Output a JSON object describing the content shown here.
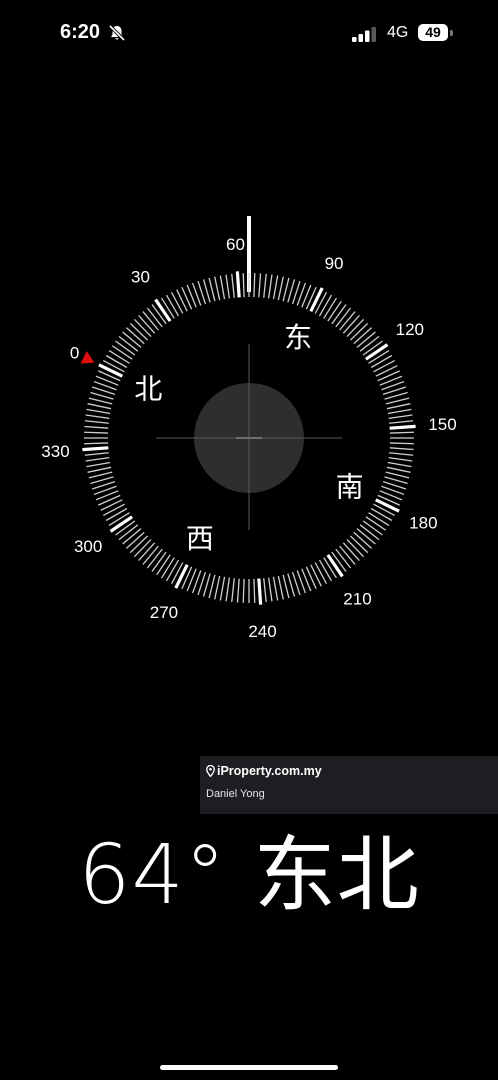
{
  "status_bar": {
    "time": "6:20",
    "mute_icon": "bell-slash-icon",
    "signal_icon": "cellular-signal-icon",
    "network": "4G",
    "battery": "49"
  },
  "compass": {
    "heading_degrees": 64,
    "degree_labels": [
      "0",
      "30",
      "60",
      "90",
      "120",
      "150",
      "180",
      "210",
      "240",
      "270",
      "300",
      "330"
    ],
    "cardinal_labels": {
      "north": "北",
      "east": "东",
      "south": "南",
      "west": "西"
    },
    "north_marker_color": "#e01010",
    "accent_color": "#ffffff"
  },
  "watermark": {
    "logo": "iProperty.com.my",
    "logo_icon": "location-pin-icon",
    "author": "Daniel Yong"
  },
  "heading_readout": "64° 东北"
}
